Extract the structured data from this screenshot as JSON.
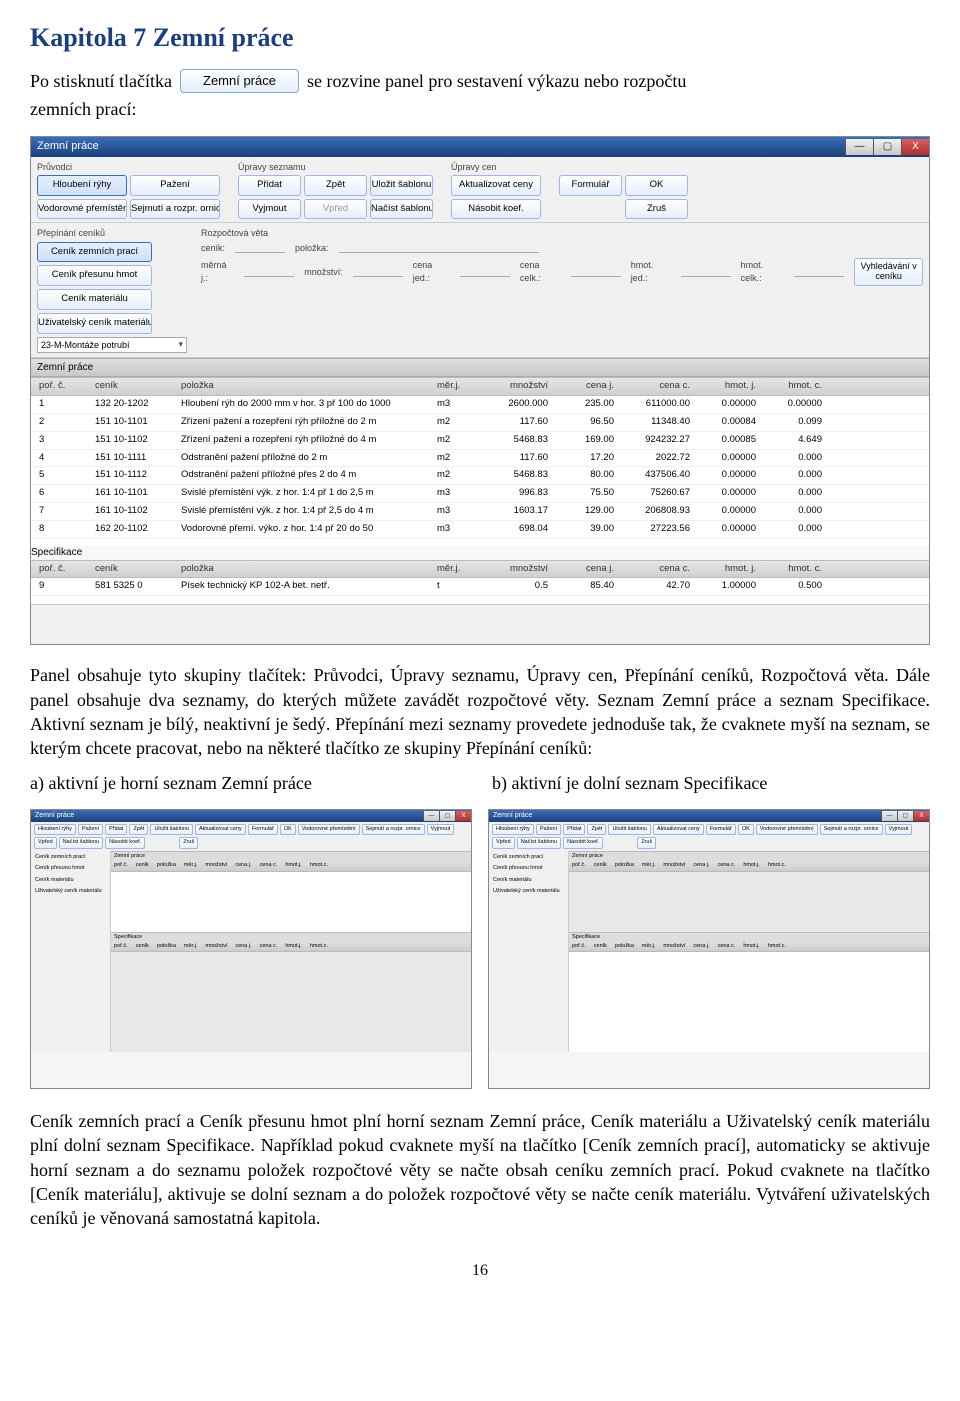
{
  "page": {
    "chapter_title": "Kapitola 7  Zemní práce",
    "intro_before": "Po stisknutí tlačítka",
    "button_label": "Zemní práce",
    "intro_after": "se rozvine panel pro sestavení výkazu nebo rozpočtu",
    "intro_line2": "zemních prací:",
    "para2": "Panel obsahuje tyto skupiny tlačítek: Průvodci, Úpravy seznamu, Úpravy cen, Přepínání ceníků, Rozpočtová věta. Dále panel obsahuje dva seznamy, do kterých můžete zavádět rozpočtové věty. Seznam Zemní práce a seznam Specifikace. Aktivní seznam je bílý, neaktivní je šedý. Přepínání mezi seznamy provedete jednoduše tak, že cvaknete myší na seznam, se kterým chcete pracovat, nebo na některé tlačítko ze skupiny Přepínání ceníků:",
    "col_a": "a) aktivní je horní seznam Zemní práce",
    "col_b": "b) aktivní je dolní seznam Specifikace",
    "para3": "Ceník zemních prací a Ceník přesunu hmot plní horní seznam Zemní práce, Ceník materiálu a Uživatelský ceník materiálu plní dolní seznam Specifikace. Například pokud cvaknete myší na tlačítko [Ceník zemních prací], automaticky se aktivuje horní seznam a do seznamu položek rozpočtové věty se načte obsah ceníku zemních prací. Pokud cvaknete na tlačítko [Ceník materiálu], aktivuje se dolní seznam a do položek rozpočtové věty se načte ceník materiálu. Vytváření uživatelských ceníků je věnovaná samostatná kapitola.",
    "page_number": "16"
  },
  "app": {
    "title": "Zemní práce",
    "groups": {
      "pruvodci": {
        "label": "Průvodci",
        "r1": [
          "Hloubení rýhy",
          "Pažení"
        ],
        "r2": [
          "Vodorovné přemístění",
          "Sejmutí a rozpr. ornice"
        ]
      },
      "upravy_seznamu": {
        "label": "Úpravy seznamu",
        "r1": [
          "Přidat",
          "Zpět",
          "Uložit šablonu"
        ],
        "r2": [
          "Vyjmout",
          "Vpřed",
          "Načíst šablonu"
        ]
      },
      "upravy_cen": {
        "label": "Úpravy cen",
        "r1": [
          "Aktualizovat ceny"
        ],
        "r2": [
          "Násobit koef."
        ]
      },
      "form": {
        "r1": [
          "Formulář",
          "OK"
        ],
        "r2": [
          "",
          "Zruš"
        ]
      }
    },
    "switch": {
      "label": "Přepínání ceníků",
      "items": [
        "Ceník zemních prací",
        "Ceník přesunu hmot",
        "Ceník materiálu",
        "Uživatelský ceník materiálu"
      ]
    },
    "meta": {
      "label": "Rozpočtová věta",
      "labels": {
        "cenik": "ceník:",
        "polozka": "položka:",
        "merna": "měrná j.:",
        "mnozstvi": "množství:",
        "cenajed": "cena jed.:",
        "cenacelk": "cena celk.:",
        "hmotjed": "hmot. jed.:",
        "hmotcelk": "hmot. celk.:"
      },
      "search": "Vyhledávání v ceníku",
      "dropdown": "23-M-Montáže potrubí"
    },
    "table": {
      "section_title": "Zemní práce",
      "headers": [
        "poř. č.",
        "ceník",
        "položka",
        "měr.j.",
        "množství",
        "cena j.",
        "cena c.",
        "hmot. j.",
        "hmot. c."
      ],
      "rows": [
        [
          "1",
          "132 20-1202",
          "Hloubení rýh do 2000 mm v hor. 3 př 100 do 1000",
          "m3",
          "2600.000",
          "235.00",
          "611000.00",
          "0.00000",
          "0.00000"
        ],
        [
          "2",
          "151 10-1101",
          "Zřízení pažení a rozepření rýh příložné do 2 m",
          "m2",
          "117.60",
          "96.50",
          "11348.40",
          "0.00084",
          "0.099"
        ],
        [
          "3",
          "151 10-1102",
          "Zřízení pažení a rozepření rýh příložné do 4 m",
          "m2",
          "5468.83",
          "169.00",
          "924232.27",
          "0.00085",
          "4.649"
        ],
        [
          "4",
          "151 10-1111",
          "Odstranění pažení příložné do 2 m",
          "m2",
          "117.60",
          "17.20",
          "2022.72",
          "0.00000",
          "0.000"
        ],
        [
          "5",
          "151 10-1112",
          "Odstranění pažení příložné přes 2 do 4 m",
          "m2",
          "5468.83",
          "80.00",
          "437506.40",
          "0.00000",
          "0.000"
        ],
        [
          "6",
          "161 10-1101",
          "Svislé přemístění výk. z hor. 1:4 př 1 do 2,5 m",
          "m3",
          "996.83",
          "75.50",
          "75260.67",
          "0.00000",
          "0.000"
        ],
        [
          "7",
          "161 10-1102",
          "Svislé přemístění výk. z hor. 1:4 př 2,5 do 4 m",
          "m3",
          "1603.17",
          "129.00",
          "206808.93",
          "0.00000",
          "0.000"
        ],
        [
          "8",
          "162 20-1102",
          "Vodorovné přemí. výko. z hor. 1:4 př 20 do 50",
          "m3",
          "698.04",
          "39.00",
          "27223.56",
          "0.00000",
          "0.000"
        ]
      ]
    },
    "spec": {
      "section_title": "Specifikace",
      "headers": [
        "poř. č.",
        "ceník",
        "položka",
        "měr.j.",
        "množství",
        "cena j.",
        "cena c.",
        "hmot. j.",
        "hmot. c."
      ],
      "rows": [
        [
          "9",
          "581 5325 0",
          "Písek technický KP 102-A bet. netř.",
          "t",
          "0.5",
          "85.40",
          "42.70",
          "1.00000",
          "0.500"
        ]
      ]
    }
  },
  "mini": {
    "title": "Zemní práce",
    "top_btns": [
      "Hloubení rýhy",
      "Pažení",
      "Přidat",
      "Zpět",
      "Uložit šablonu",
      "Aktualizovat ceny",
      "Formulář",
      "OK"
    ],
    "top_btns2": [
      "Vodorovné přemístění",
      "Sejmutí a rozpr. ornice",
      "Vyjmout",
      "Vpřed",
      "Načíst šablonu",
      "Násobit koef.",
      "",
      "Zruš"
    ],
    "side": [
      "Ceník zemních prací",
      "Ceník přesunu hmot",
      "Ceník materiálu",
      "Uživatelský ceník materiálu"
    ],
    "hdr": [
      "poř.č.",
      "ceník",
      "položka",
      "měr.j.",
      "množství",
      "cena j.",
      "cena c.",
      "hmot.j.",
      "hmot.c."
    ],
    "sec1": "Zemní práce",
    "sec2": "Specifikace"
  }
}
